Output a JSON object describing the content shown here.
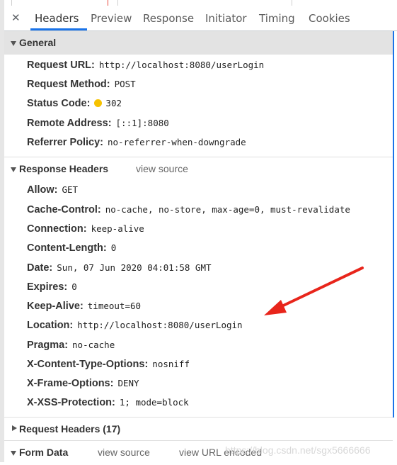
{
  "tabs": {
    "close": "✕",
    "items": [
      "Headers",
      "Preview",
      "Response",
      "Initiator",
      "Timing",
      "Cookies"
    ],
    "active": "Headers"
  },
  "general": {
    "title": "General",
    "rows": [
      {
        "key": "Request URL:",
        "value": "http://localhost:8080/userLogin"
      },
      {
        "key": "Request Method:",
        "value": "POST"
      },
      {
        "key": "Status Code:",
        "value": "302"
      },
      {
        "key": "Remote Address:",
        "value": "[::1]:8080"
      },
      {
        "key": "Referrer Policy:",
        "value": "no-referrer-when-downgrade"
      }
    ]
  },
  "response_headers": {
    "title": "Response Headers",
    "view_source": "view source",
    "rows": [
      {
        "key": "Allow:",
        "value": "GET"
      },
      {
        "key": "Cache-Control:",
        "value": "no-cache, no-store, max-age=0, must-revalidate"
      },
      {
        "key": "Connection:",
        "value": "keep-alive"
      },
      {
        "key": "Content-Length:",
        "value": "0"
      },
      {
        "key": "Date:",
        "value": "Sun, 07 Jun 2020 04:01:58 GMT"
      },
      {
        "key": "Expires:",
        "value": "0"
      },
      {
        "key": "Keep-Alive:",
        "value": "timeout=60"
      },
      {
        "key": "Location:",
        "value": "http://localhost:8080/userLogin"
      },
      {
        "key": "Pragma:",
        "value": "no-cache"
      },
      {
        "key": "X-Content-Type-Options:",
        "value": "nosniff"
      },
      {
        "key": "X-Frame-Options:",
        "value": "DENY"
      },
      {
        "key": "X-XSS-Protection:",
        "value": "1; mode=block"
      }
    ]
  },
  "request_headers": {
    "title": "Request Headers (17)"
  },
  "form_data": {
    "title": "Form Data",
    "view_source": "view source",
    "view_url_encoded": "view URL encoded"
  },
  "watermark": "https://blog.csdn.net/sgx5666666",
  "colors": {
    "accent": "#1a73e8",
    "status_dot": "#f6c200",
    "annotation_arrow": "#e8251b",
    "section_header_bg": "#e3e3e3"
  }
}
